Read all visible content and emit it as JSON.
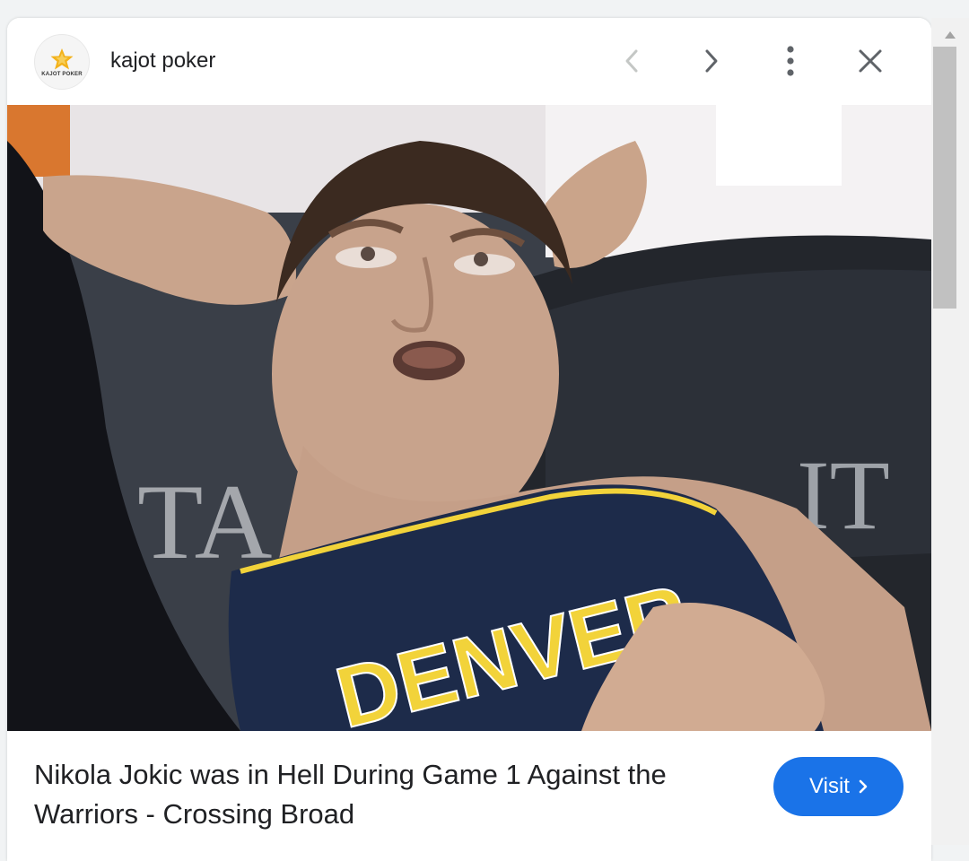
{
  "header": {
    "site_logo_text": "KAJOT POKER",
    "site_name": "kajot poker",
    "icons": [
      "chevron-left-icon",
      "chevron-right-icon",
      "more-vert-icon",
      "close-icon"
    ]
  },
  "image": {
    "jersey_text": "DENVER",
    "background_text_left": "TA",
    "background_text_right": "IT",
    "lens_icon": "google-lens-icon"
  },
  "result": {
    "title": "Nikola Jokic was in Hell During Game 1 Against the Warriors - Crossing Broad",
    "visit_label": "Visit",
    "visit_icon": "chevron-right-icon"
  },
  "colors": {
    "accent": "#1a73e8",
    "text": "#202124",
    "icon_gray": "#5f6368",
    "jersey_navy": "#1d2b4a",
    "jersey_yellow": "#f2d33a"
  }
}
